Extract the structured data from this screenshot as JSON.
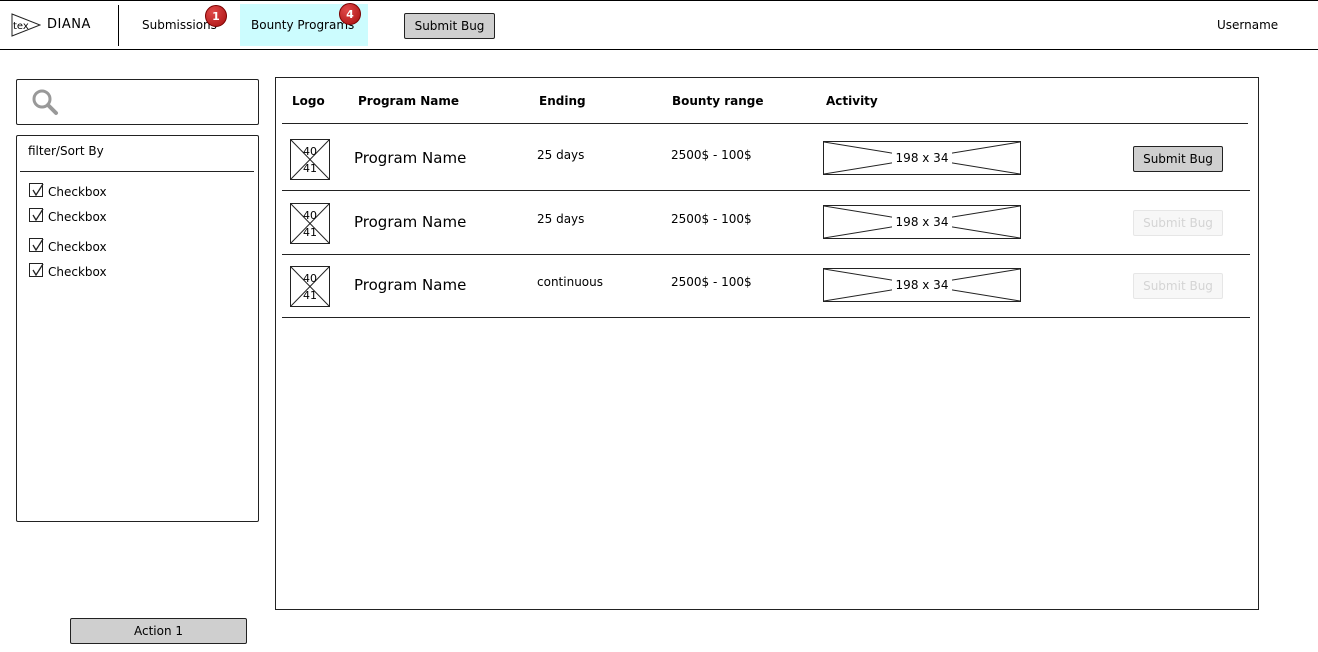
{
  "nav": {
    "brand": "DIANA",
    "logo_text": "tex",
    "items": [
      {
        "label": "Submissions",
        "badge": "1"
      },
      {
        "label": "Bounty Programs",
        "badge": "4"
      }
    ],
    "submit_label": "Submit Bug",
    "username": "Username"
  },
  "filter": {
    "title": "filter/Sort By",
    "checkboxes": [
      {
        "label": "Checkbox",
        "checked": true
      },
      {
        "label": "Checkbox",
        "checked": true
      },
      {
        "label": "Checkbox",
        "checked": true
      },
      {
        "label": "Checkbox",
        "checked": true
      }
    ]
  },
  "table": {
    "headers": [
      "Logo",
      "Program Name",
      "Ending",
      "Bounty range",
      "Activity"
    ],
    "rows": [
      {
        "logo_w": "40",
        "logo_h": "41",
        "name": "Program Name",
        "ending": "25 days",
        "bounty": "2500$ - 100$",
        "activity": "198 x 34",
        "button": "Submit Bug",
        "enabled": true
      },
      {
        "logo_w": "40",
        "logo_h": "41",
        "name": "Program Name",
        "ending": "25 days",
        "bounty": "2500$ - 100$",
        "activity": "198 x 34",
        "button": "Submit Bug",
        "enabled": false
      },
      {
        "logo_w": "40",
        "logo_h": "41",
        "name": "Program Name",
        "ending": "continuous",
        "bounty": "2500$ - 100$",
        "activity": "198 x 34",
        "button": "Submit Bug",
        "enabled": false
      }
    ]
  },
  "action_label": "Action 1",
  "colors": {
    "active_tab": "#ccfcfe",
    "badge": "#c0392b",
    "button": "#cfcfcf"
  }
}
